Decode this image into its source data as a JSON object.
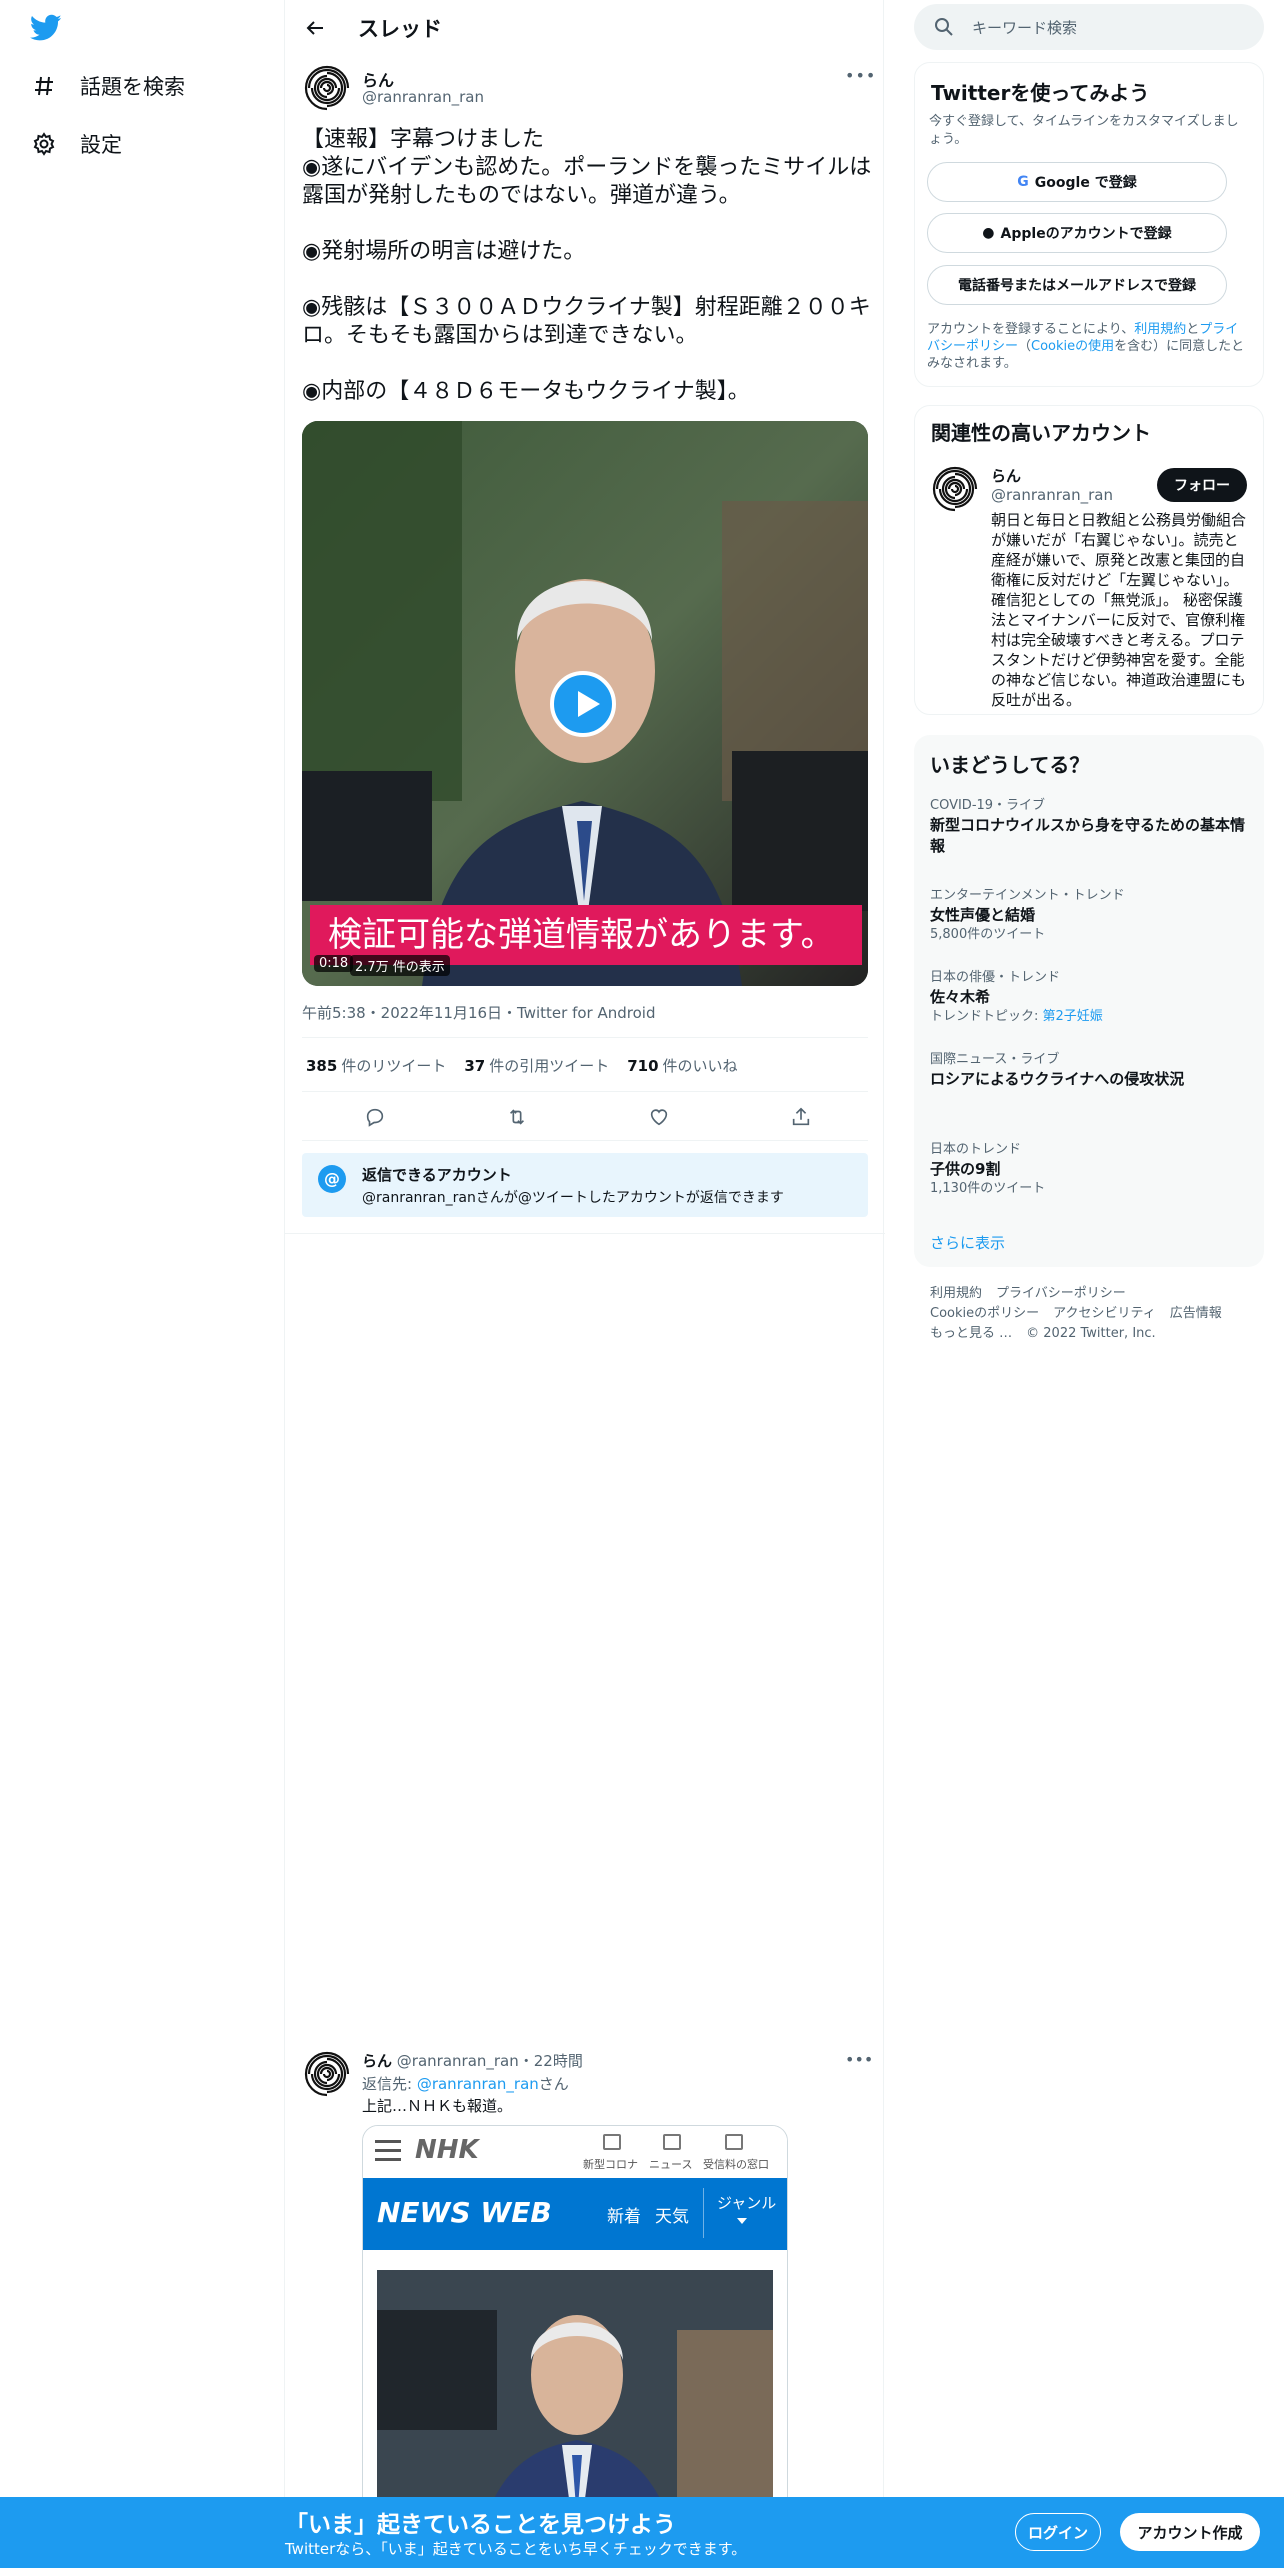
{
  "nav": {
    "logo": "twitter-bird",
    "items": [
      {
        "label": "話題を検索",
        "icon": "hashtag-icon"
      },
      {
        "label": "設定",
        "icon": "gear-icon"
      }
    ]
  },
  "thread": {
    "title": "スレッド"
  },
  "tweet": {
    "name": "らん",
    "handle": "@ranranran_ran",
    "text": "【速報】字幕つけました\n◉遂にバイデンも認めた。ポーランドを襲ったミサイルは露国が発射したものではない。弾道が違う。\n\n◉発射場所の明言は避けた。\n\n◉残骸は【Ｓ３００ＡＤウクライナ製】射程距離２００キロ。そもそも露国からは到達できない。\n\n◉内部の【４８Ｄ６モータもウクライナ製】。",
    "media": {
      "subtitle": "検証可能な弾道情報があります。",
      "duration": "0:18",
      "views": "2.7万 件の表示"
    },
    "meta": "午前5:38・2022年11月16日・Twitter for Android",
    "stats": {
      "retweets": "385",
      "retweets_label": "件のリツイート",
      "quotes": "37",
      "quotes_label": "件の引用ツイート",
      "likes": "710",
      "likes_label": "件のいいね"
    },
    "actions": [
      "reply-icon",
      "retweet-icon",
      "like-icon",
      "share-icon"
    ],
    "reply_restriction": {
      "title": "返信できるアカウント",
      "subtitle": "@ranranran_ranさんが@ツイートしたアカウントが返信できます"
    }
  },
  "reply_tweet": {
    "name": "らん",
    "handle": "@ranranran_ran",
    "time": "・22時間",
    "reply_to_prefix": "返信先: ",
    "reply_to": "@ranranran_ran",
    "reply_to_suffix": "さん",
    "text": "上記…ＮＨＫも報道。",
    "nhk": {
      "logo": "NHK",
      "menu": [
        "新型コロナ",
        "ニュース",
        "受信料の窓口"
      ],
      "news_web": "NEWS WEB",
      "tabs": [
        "新着",
        "天気"
      ],
      "genre": "ジャンル"
    }
  },
  "search": {
    "placeholder": "キーワード検索"
  },
  "signup": {
    "title": "Twitterを使ってみよう",
    "subtitle": "今すぐ登録して、タイムラインをカスタマイズしましょう。",
    "google": "Google で登録",
    "apple": "Appleのアカウントで登録",
    "phone": "電話番号またはメールアドレスで登録",
    "legal_1": "アカウントを登録することにより、",
    "legal_terms": "利用規約",
    "legal_and": "と",
    "legal_privacy": "プライバシーポリシー",
    "legal_open": "（",
    "legal_cookie": "Cookieの使用",
    "legal_2": "を含む）に同意したとみなされます。"
  },
  "related": {
    "title": "関連性の高いアカウント",
    "name": "らん",
    "handle": "@ranranran_ran",
    "follow": "フォロー",
    "bio": "朝日と毎日と日教組と公務員労働組合が嫌いだが「右翼じゃない」。読売と産経が嫌いで、原発と改憲と集団的自衛権に反対だけど「左翼じゃない」。確信犯としての「無党派」。 秘密保護法とマイナンバーに反対で、官僚利権村は完全破壊すべきと考える。プロテスタントだけど伊勢神宮を愛す。全能の神など信じない。神道政治連盟にも反吐が出る。"
  },
  "trends": {
    "title": "いまどうしてる？",
    "items": [
      {
        "category": "COVID-19・ライブ",
        "name": "新型コロナウイルスから身を守るための基本情報"
      },
      {
        "category": "エンターテインメント・トレンド",
        "name": "女性声優と結婚",
        "count": "5,800件のツイート"
      },
      {
        "category": "日本の俳優・トレンド",
        "name": "佐々木希",
        "topic_prefix": "トレンドトピック: ",
        "topic": "第2子妊娠"
      },
      {
        "category": "国際ニュース・ライブ",
        "name": "ロシアによるウクライナへの侵攻状況"
      },
      {
        "category": "日本のトレンド",
        "name": "子供の9割",
        "count": "1,130件のツイート"
      }
    ],
    "more": "さらに表示"
  },
  "footer": {
    "links": [
      "利用規約",
      "プライバシーポリシー",
      "Cookieのポリシー",
      "アクセシビリティ",
      "広告情報",
      "もっと見る …"
    ],
    "copyright": "© 2022 Twitter, Inc."
  },
  "bottom_bar": {
    "title": "「いま」起きていることを見つけよう",
    "subtitle": "Twitterなら、「いま」起きていることをいち早くチェックできます。",
    "login": "ログイン",
    "signup": "アカウント作成"
  },
  "colors": {
    "accent": "#1d9bf0",
    "text": "#0f1419",
    "muted": "#536471",
    "subtitle_bg": "#e0195c",
    "nhk_blue": "#0076d1"
  }
}
